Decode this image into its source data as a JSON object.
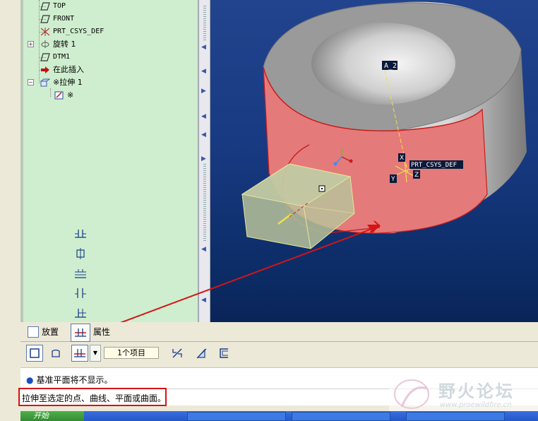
{
  "model_tree": {
    "items": [
      {
        "label": "TOP",
        "icon": "datum-plane-icon"
      },
      {
        "label": "FRONT",
        "icon": "datum-plane-icon"
      },
      {
        "label": "PRT_CSYS_DEF",
        "icon": "csys-icon"
      },
      {
        "label": "旋转 1",
        "icon": "revolve-icon"
      },
      {
        "label": "DTM1",
        "icon": "datum-plane-icon"
      },
      {
        "label": "在此插入",
        "icon": "insert-here-arrow-icon"
      },
      {
        "label": "※拉伸 1",
        "icon": "extrude-icon"
      },
      {
        "label": "※",
        "icon": "sketch-icon"
      }
    ]
  },
  "viewport": {
    "axis_label": "A_2",
    "csys_label": "PRT_CSYS_DEF",
    "csys_x": "X",
    "csys_y": "Y",
    "csys_z": "Z"
  },
  "dashboard": {
    "tabs": [
      {
        "label": "放置"
      },
      {
        "label": "属性"
      }
    ],
    "reference_field": "1个项目",
    "message": "基准平面将不显示。",
    "prompt": "拉伸至选定的点、曲线、平面或曲面。"
  },
  "depth_options": [
    "symmetric-depth-icon",
    "to-next-depth-icon",
    "through-all-depth-icon",
    "through-until-depth-icon",
    "to-selected-depth-icon",
    "to-selected-depth-icon-active"
  ],
  "taskbar": {
    "start": "开始"
  },
  "watermark": {
    "title": "野火论坛",
    "url": "www.proewildfire.cn"
  },
  "colors": {
    "tree_bg": "#cfeecf",
    "viewport_top": "#22448e",
    "viewport_bottom": "#0a2458",
    "highlight_red": "#d41515",
    "part_face": "#e57a7a"
  }
}
